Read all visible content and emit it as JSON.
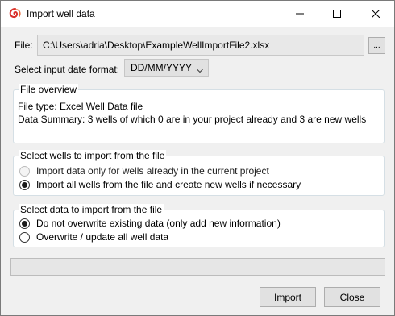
{
  "window": {
    "title": "Import well data",
    "icon": "swirl-app-icon",
    "controls": [
      "minimize-icon",
      "maximize-icon",
      "close-icon"
    ]
  },
  "file": {
    "label": "File:",
    "path": "C:\\Users\\adria\\Desktop\\ExampleWellImportFile2.xlsx",
    "browse_label": "..."
  },
  "date_format": {
    "label": "Select input date format:",
    "selected": "DD/MM/YYYY"
  },
  "overview": {
    "title": "File overview",
    "file_type": "File type: Excel Well Data file",
    "summary": "Data Summary: 3 wells of which 0 are in your project already and 3 are new wells"
  },
  "wells_group": {
    "title": "Select wells to import from the file",
    "options": [
      {
        "label": "Import data only for wells already in the current project",
        "selected": false,
        "enabled": false
      },
      {
        "label": "Import all wells from the file and create new wells if necessary",
        "selected": true,
        "enabled": true
      }
    ]
  },
  "data_group": {
    "title": "Select data to import from the file",
    "options": [
      {
        "label": "Do not overwrite existing data (only add new information)",
        "selected": true,
        "enabled": true
      },
      {
        "label": "Overwrite / update all well data",
        "selected": false,
        "enabled": true
      }
    ]
  },
  "progress": {
    "value": 0
  },
  "buttons": {
    "import": "Import",
    "close": "Close"
  },
  "colors": {
    "app_icon": "#d9302c",
    "progress_fill": "#06b025",
    "group_border": "#d5dfe5"
  }
}
